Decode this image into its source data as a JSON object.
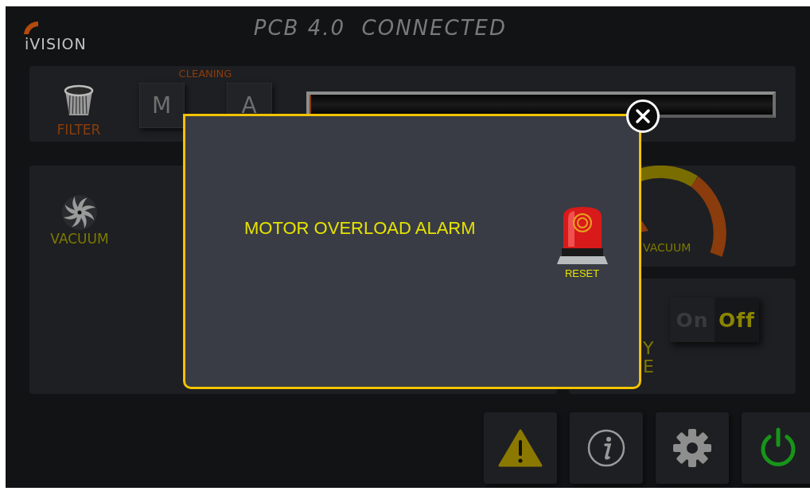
{
  "header": {
    "logo": "iVISION",
    "title": "PCB 4.0  CONNECTED"
  },
  "filter": {
    "label": "FILTER",
    "cleaning_label": "CLEANING",
    "modes": [
      {
        "label": "M"
      },
      {
        "label": "A"
      }
    ],
    "level": 0
  },
  "vacuum": {
    "label": "VACUUM"
  },
  "gauge": {
    "label": "VACUUM"
  },
  "switch": {
    "on": false,
    "on_label": "On",
    "off_label": "Off",
    "caption_lines": [
      "Y",
      "E"
    ]
  },
  "alarm": {
    "message": "MOTOR OVERLOAD ALARM",
    "reset_label": "RESET"
  },
  "toolbar": [
    {
      "kind": "warning"
    },
    {
      "kind": "info"
    },
    {
      "kind": "settings"
    },
    {
      "kind": "power"
    }
  ]
}
